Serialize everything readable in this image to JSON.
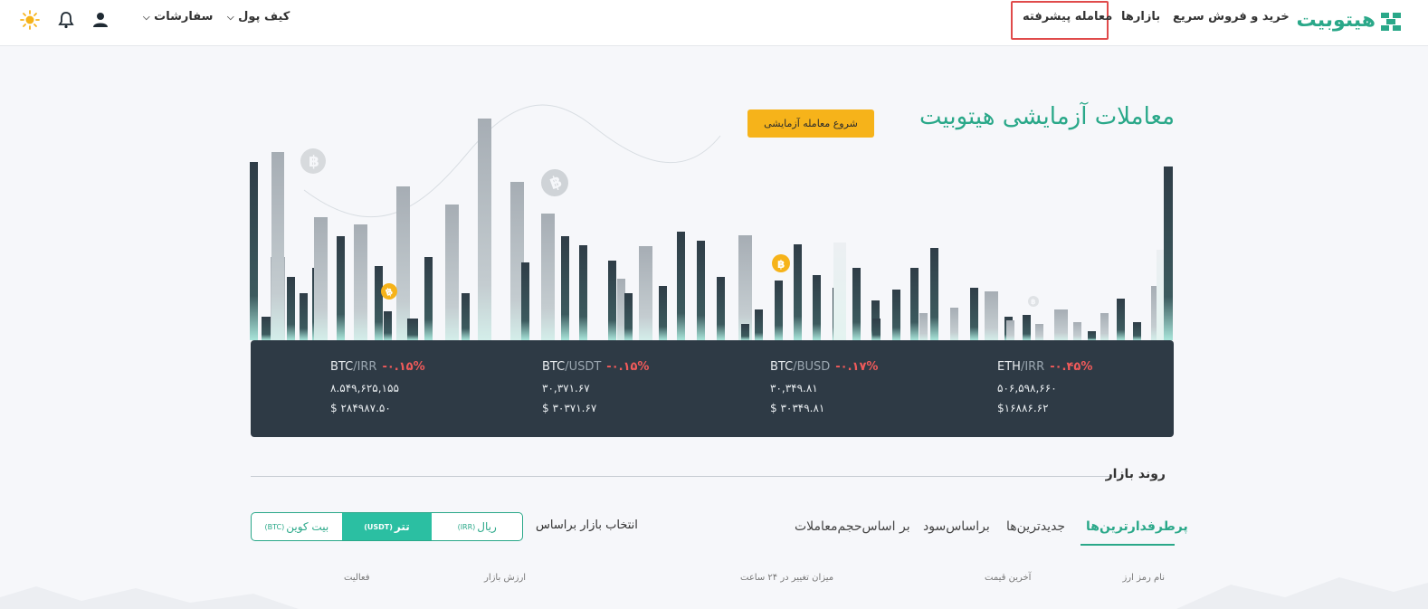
{
  "nav": {
    "logo_text": "هیتوبیت",
    "quick_trade": "خرید و فروش سریع",
    "markets": "بازارها",
    "advanced_trade": "معامله پیشرفته",
    "wallet": "کیف پول",
    "orders": "سفارشات"
  },
  "hero": {
    "title": "معاملات آزمایشی هیتوبیت",
    "demo_button": "شروع معامله آزمایشی"
  },
  "ticker": [
    {
      "base": "BTC",
      "quote": "/IRR",
      "change": "-۰.۱۵%",
      "price": "۸.۵۴۹,۶۲۵,۱۵۵",
      "usd": "$ ۲۸۴۹۸۷.۵۰"
    },
    {
      "base": "BTC",
      "quote": "/USDT",
      "change": "-۰.۱۵%",
      "price": "۳۰,۳۷۱.۶۷",
      "usd": "$ ۳۰۳۷۱.۶۷"
    },
    {
      "base": "BTC",
      "quote": "/BUSD",
      "change": "-۰.۱۷%",
      "price": "۳۰,۳۴۹.۸۱",
      "usd": "$ ۳۰۳۴۹.۸۱"
    },
    {
      "base": "ETH",
      "quote": "/IRR",
      "change": "-۰.۴۵%",
      "price": "۵۰۶,۵۹۸,۶۶۰",
      "usd": "$۱۶۸۸۶.۶۲"
    }
  ],
  "trend": {
    "title": "روند بازار",
    "tabs": [
      "پرطرفدارترین‌ها",
      "جدیدترین‌ها",
      "براساس‌سود",
      "بر اساس‌حجم‌معاملات"
    ],
    "select_label": "انتخاب بازار براساس",
    "segments": [
      {
        "label": "ریال",
        "code": "(IRR)"
      },
      {
        "label": "تتر",
        "code": "(USDT)"
      },
      {
        "label": "بیت کوین",
        "code": "(BTC)"
      }
    ],
    "columns": [
      "نام رمز ارز",
      "آخرین قیمت",
      "میزان تغییر در ۲۴ ساعت",
      "ارزش بازار",
      "فعالیت"
    ]
  },
  "colors": {
    "accent": "#2aa889",
    "warning": "#f6b31a",
    "negative": "#ef5a5a",
    "dark_panel": "#2e3a45"
  },
  "icons": [
    "logo-mark-icon",
    "chevron-down-icon",
    "user-icon",
    "bell-icon",
    "sun-icon",
    "bitcoin-icon"
  ]
}
